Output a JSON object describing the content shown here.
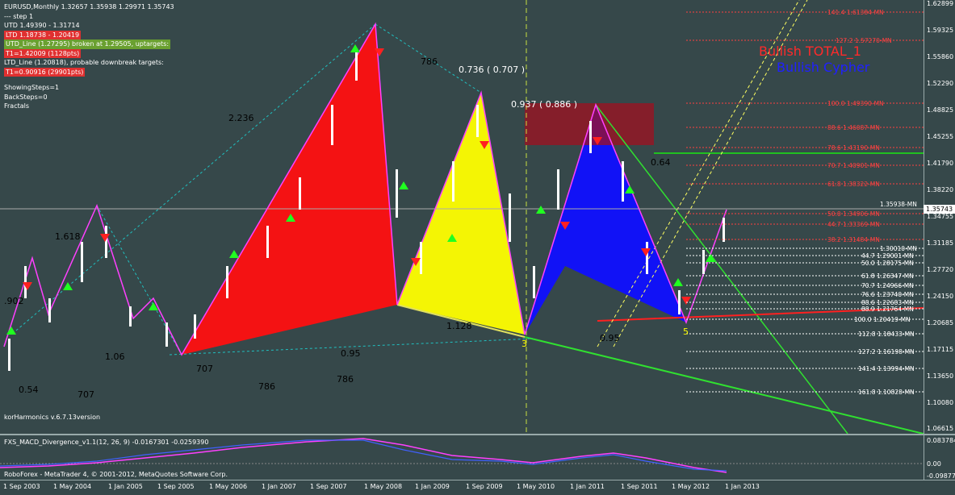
{
  "window": {
    "symbol_line": "EURUSD,Monthly  1.32657 1.35938 1.29971 1.35743"
  },
  "info_panel": {
    "step_line": "---   step 1",
    "utd": "UTD 1.49390 - 1.31714",
    "ltd": "LTD 1.18738 - 1.20419",
    "utd_line": "UTD_Line (1.27295) broken at 1.29505, uptargets:",
    "t1_up": "T1=1.42009 (1128pts)",
    "ltd_line": "LTD_Line (1.20818), probable downbreak targets:",
    "t1_down": "T1=0.90916 (29901pts)",
    "showing_steps": "ShowingSteps=1",
    "back_steps": "BackSteps=0",
    "fractals": "Fractals"
  },
  "pattern_titles": {
    "total": "Bullish TOTAL_1",
    "cypher": "Bullish Cypher"
  },
  "version_label": "korHarmonics v.6.7.13version",
  "macd": {
    "label": "FXS_MACD_Divergence_v1.1(12, 26, 9) -0.0167301 -0.0259390",
    "top_value": "0.083784",
    "zero_value": "0.00",
    "bottom_value": "-0.098777"
  },
  "copyright": "RoboForex - MetaTrader 4, © 2001-2012, MetaQuotes Software Corp.",
  "current_price": "1.35743",
  "price_axis": [
    "1.62899",
    "1.59325",
    "1.55860",
    "1.52290",
    "1.48825",
    "1.45255",
    "1.41790",
    "1.38220",
    "1.34755",
    "1.31185",
    "1.27720",
    "1.24150",
    "1.20685",
    "1.17115",
    "1.13650",
    "1.10080",
    "1.06615"
  ],
  "time_axis": [
    "1 Sep 2003",
    "1 May 2004",
    "1 Jan 2005",
    "1 Sep 2005",
    "1 May 2006",
    "1 Jan 2007",
    "1 Sep 2007",
    "1 May 2008",
    "1 Jan 2009",
    "1 Sep 2009",
    "1 May 2010",
    "1 Jan 2011",
    "1 Sep 2011",
    "1 May 2012",
    "1 Jan 2013"
  ],
  "fib_levels_right": [
    {
      "label": "141.4  1.61384-MN",
      "color": "#ff4040"
    },
    {
      "label": "127.2  1.57270-MN",
      "color": "#ff4040"
    },
    {
      "label": "100.0  1.49390-MN",
      "color": "#ff4040"
    },
    {
      "label": "88.6  1.46087-MN",
      "color": "#ff4040"
    },
    {
      "label": "78.6  1.43190-MN",
      "color": "#ff4040"
    },
    {
      "label": "70.7  1.40901-MN",
      "color": "#ff4040"
    },
    {
      "label": "61.8  1.38322-MN",
      "color": "#ff4040"
    },
    {
      "label": "1.35938-MN",
      "color": "#ffffff"
    },
    {
      "label": "50.0  1.34906-MN",
      "color": "#ff4040"
    },
    {
      "label": "44.7  1.33369-MN",
      "color": "#ff4040"
    },
    {
      "label": "38.2  1.31484-MN",
      "color": "#ff4040"
    },
    {
      "label": "1.30010-MN",
      "color": "#ffffff"
    },
    {
      "label": "44.7  1.29001-MN",
      "color": "#ffffff"
    },
    {
      "label": "50.0  1.28175-MN",
      "color": "#ffffff"
    },
    {
      "label": "61.8  1.26347-MN",
      "color": "#ffffff"
    },
    {
      "label": "70.7  1.24966-MN",
      "color": "#ffffff"
    },
    {
      "label": "76.6  1.23740-MN",
      "color": "#ffffff"
    },
    {
      "label": "88.6  1.22683-MN",
      "color": "#ffffff"
    },
    {
      "label": "88.9  1.21764-MN",
      "color": "#ffffff"
    },
    {
      "label": "100.0  1.20419-MN",
      "color": "#ffffff"
    },
    {
      "label": "112.8  1.18433-MN",
      "color": "#ffffff"
    },
    {
      "label": "127.2  1.16198-MN",
      "color": "#ffffff"
    },
    {
      "label": "141.4  1.13994-MN",
      "color": "#ffffff"
    },
    {
      "label": "161.8  1.10828-MN",
      "color": "#ffffff"
    }
  ],
  "ratio_labels": [
    {
      "text": "2.236"
    },
    {
      "text": "1.618"
    },
    {
      "text": ".902"
    },
    {
      "text": "0.54"
    },
    {
      "text": "1.06"
    },
    {
      "text": "707"
    },
    {
      "text": "707"
    },
    {
      "text": "786"
    },
    {
      "text": "0.736 ( 0.707 )"
    },
    {
      "text": "0.937 ( 0.886 )"
    },
    {
      "text": "0.64"
    },
    {
      "text": "0.95"
    },
    {
      "text": "0.95"
    },
    {
      "text": "786"
    },
    {
      "text": "786"
    },
    {
      "text": "1.128"
    },
    {
      "text": "3"
    },
    {
      "text": "5"
    }
  ],
  "colors": {
    "background": "#36484a",
    "bull_candle": "#ffffff",
    "bear_candle": "#2a8a2a",
    "pattern_red": "#ff1010",
    "pattern_yellow": "#ffff00",
    "pattern_blue": "#1010ff",
    "up_arrow": "#20ff20",
    "down_arrow": "#ff2020",
    "trend_green": "#30e030"
  }
}
